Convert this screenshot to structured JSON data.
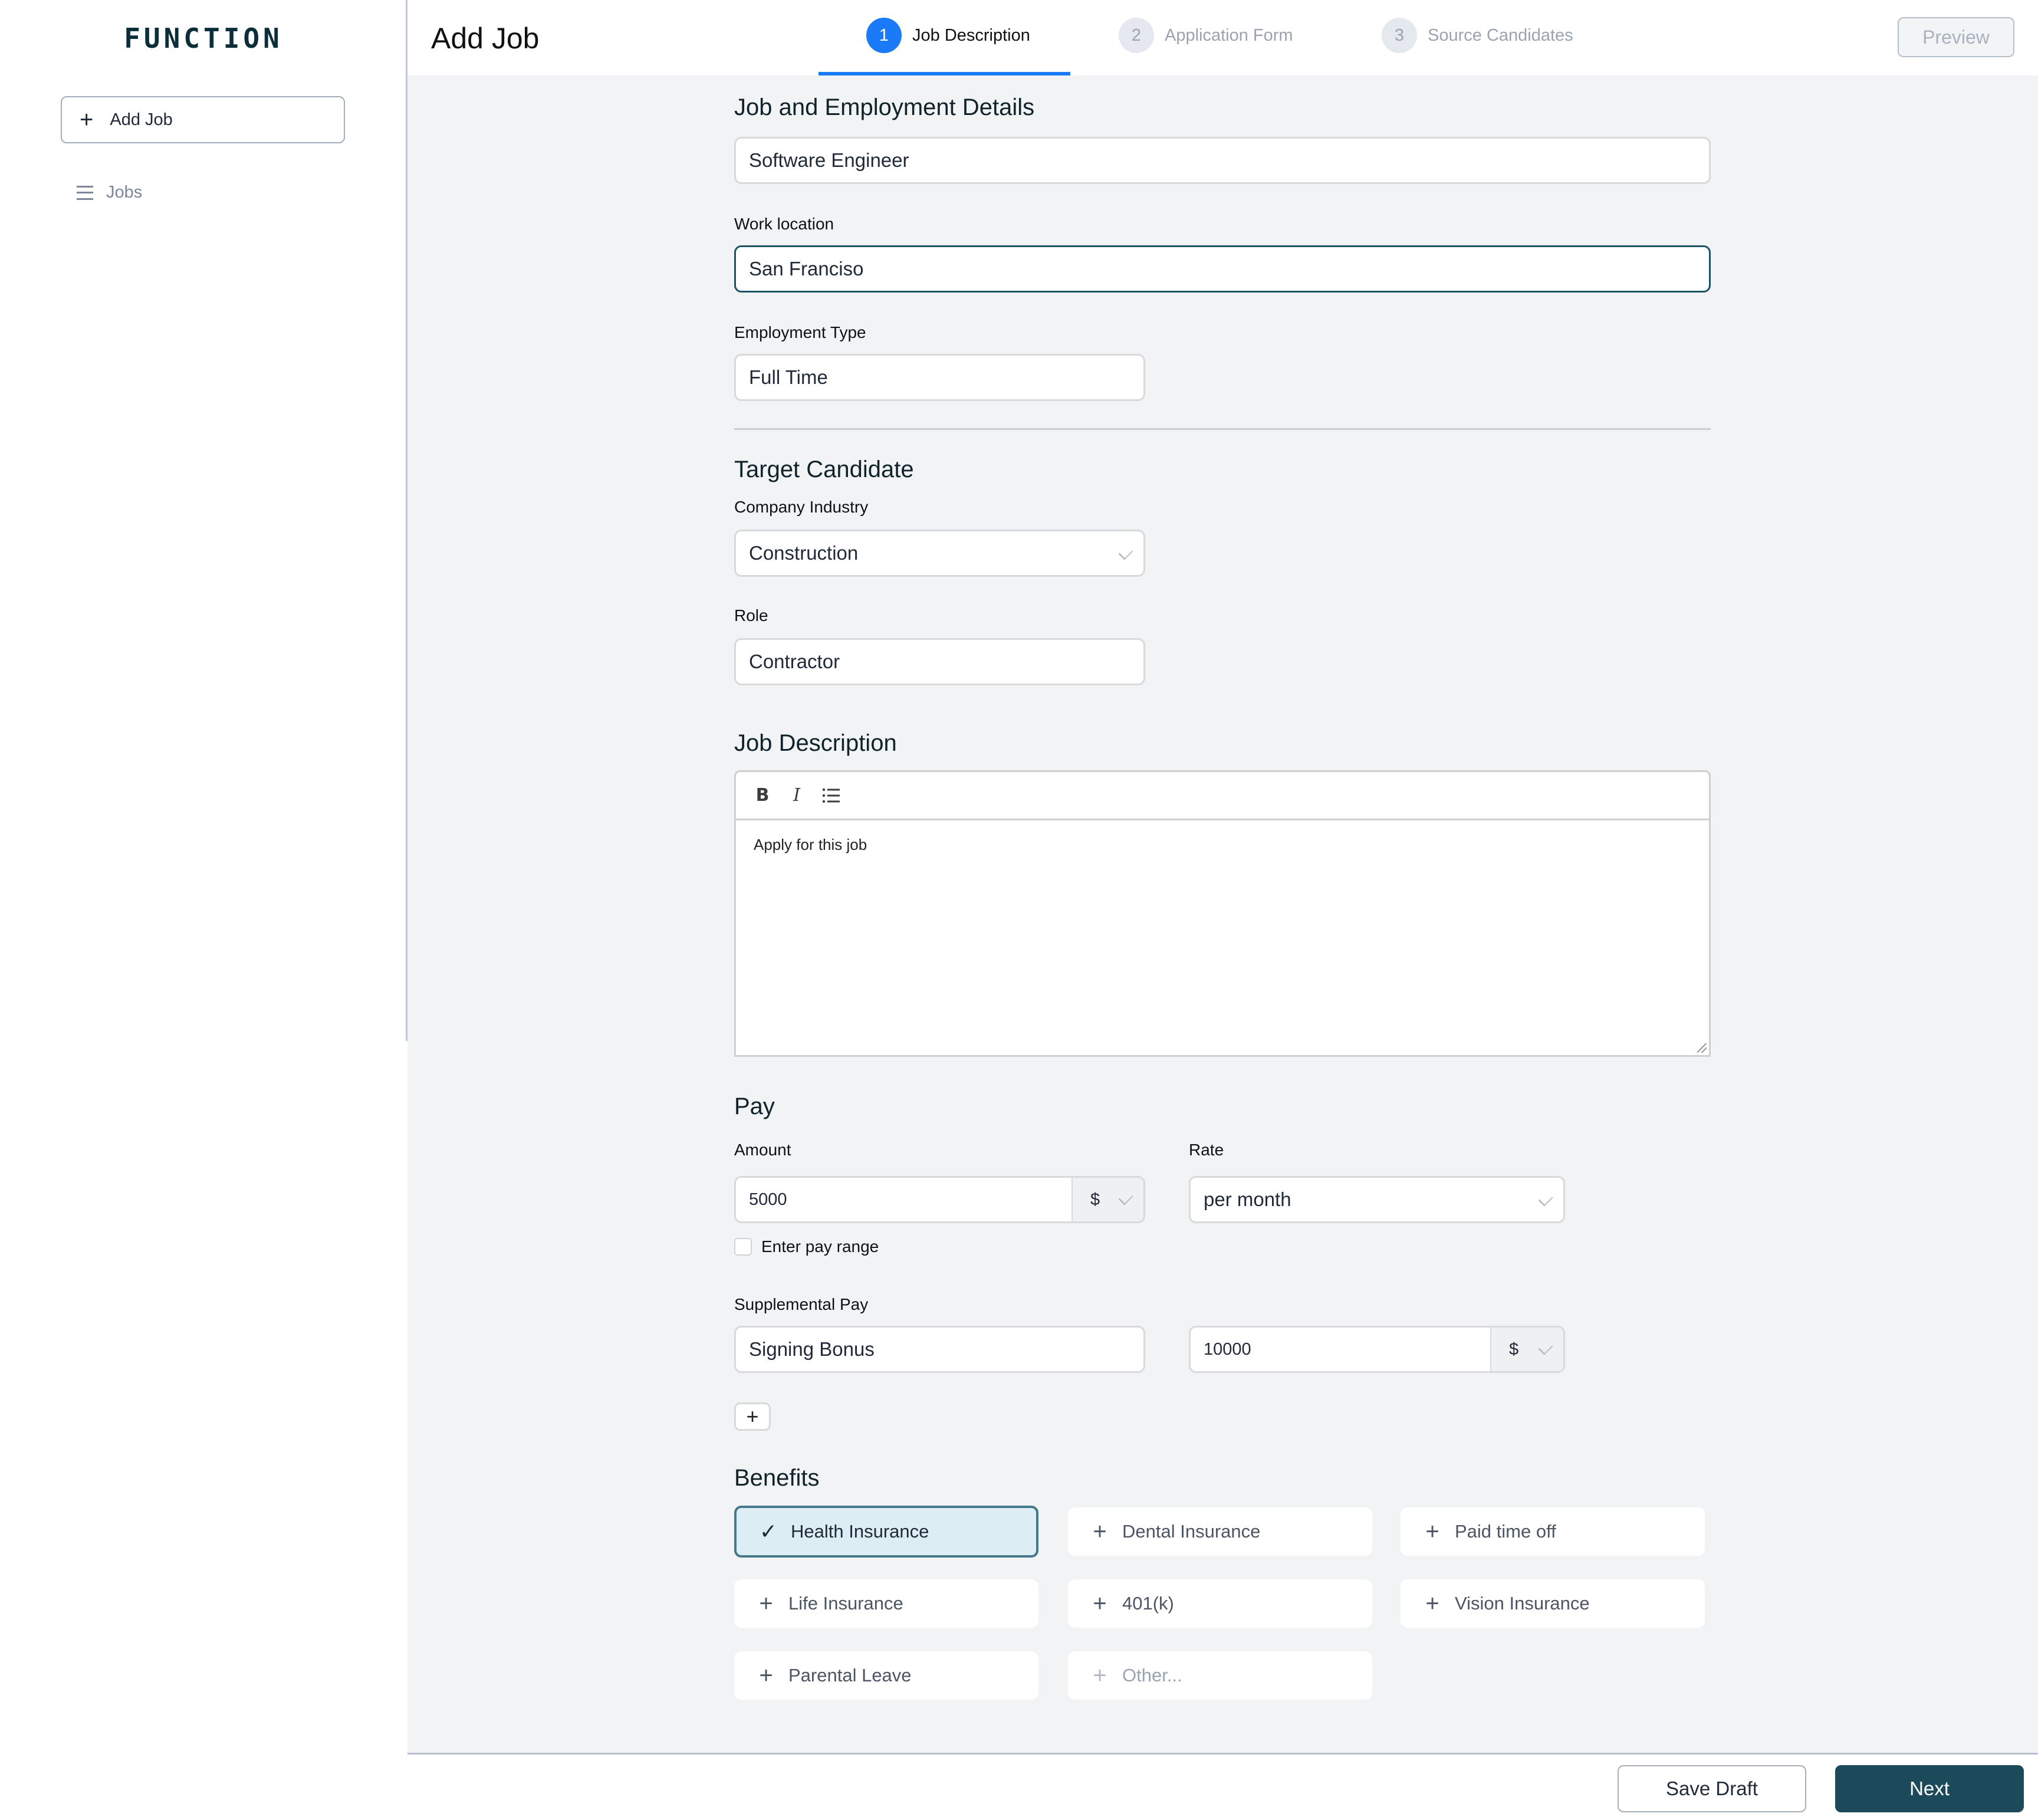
{
  "sidebar": {
    "logo": "FUNCTION",
    "add_job_label": "Add Job",
    "nav": [
      {
        "label": "Jobs",
        "icon": "hamburger-icon"
      }
    ]
  },
  "header": {
    "title": "Add Job",
    "steps": [
      {
        "num": "1",
        "label": "Job Description",
        "active": true
      },
      {
        "num": "2",
        "label": "Application Form",
        "active": false
      },
      {
        "num": "3",
        "label": "Source Candidates",
        "active": false
      }
    ],
    "preview_label": "Preview",
    "accent_color": "#1a7af8"
  },
  "job_details": {
    "section_title": "Job and Employment Details",
    "job_title_value": "Software Engineer",
    "work_location_label": "Work location",
    "work_location_value": "San Franciso",
    "employment_type_label": "Employment Type",
    "employment_type_value": "Full Time"
  },
  "target_candidate": {
    "section_title": "Target Candidate",
    "industry_label": "Company Industry",
    "industry_value": "Construction",
    "role_label": "Role",
    "role_value": "Contractor"
  },
  "description": {
    "section_title": "Job Description",
    "toolbar": {
      "bold": "B",
      "italic": "I",
      "list": "list"
    },
    "body": "Apply for this job"
  },
  "pay": {
    "section_title": "Pay",
    "amount_label": "Amount",
    "amount_value": "5000",
    "currency": "$",
    "rate_label": "Rate",
    "rate_value": "per month",
    "range_checkbox_label": "Enter pay range",
    "range_checked": false,
    "supplemental_label": "Supplemental Pay",
    "supplemental_type": "Signing Bonus",
    "supplemental_amount": "10000",
    "supplemental_currency": "$"
  },
  "benefits": {
    "section_title": "Benefits",
    "items": [
      {
        "label": "Health Insurance",
        "selected": true
      },
      {
        "label": "Dental Insurance",
        "selected": false
      },
      {
        "label": "Paid time off",
        "selected": false
      },
      {
        "label": "Life Insurance",
        "selected": false
      },
      {
        "label": "401(k)",
        "selected": false
      },
      {
        "label": "Vision Insurance",
        "selected": false
      },
      {
        "label": "Parental Leave",
        "selected": false
      },
      {
        "label": "Other...",
        "selected": false
      }
    ]
  },
  "footer": {
    "save_draft_label": "Save Draft",
    "next_label": "Next",
    "primary_color": "#1c4a5a"
  }
}
